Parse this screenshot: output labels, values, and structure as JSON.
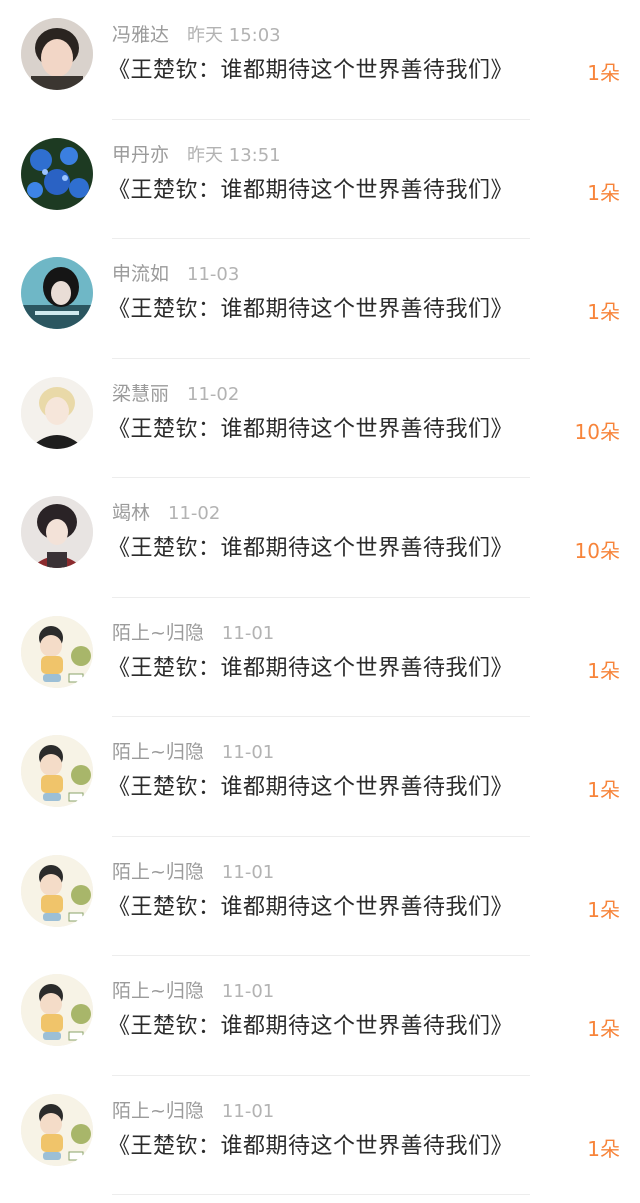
{
  "feed": {
    "items": [
      {
        "username": "冯雅达",
        "time": "昨天 15:03",
        "title": "《王楚钦：谁都期待这个世界善待我们》",
        "count": "1朵",
        "avatar": "photo-portrait"
      },
      {
        "username": "甲丹亦",
        "time": "昨天 13:51",
        "title": "《王楚钦：谁都期待这个世界善待我们》",
        "count": "1朵",
        "avatar": "blue-flowers"
      },
      {
        "username": "申流如",
        "time": "11-03",
        "title": "《王楚钦：谁都期待这个世界善待我们》",
        "count": "1朵",
        "avatar": "anime-dark"
      },
      {
        "username": "梁慧丽",
        "time": "11-02",
        "title": "《王楚钦：谁都期待这个世界善待我们》",
        "count": "10朵",
        "avatar": "anime-blond"
      },
      {
        "username": "竭林",
        "time": "11-02",
        "title": "《王楚钦：谁都期待这个世界善待我们》",
        "count": "10朵",
        "avatar": "anime-dark-hair"
      },
      {
        "username": "陌上~归隐",
        "time": "11-01",
        "title": "《王楚钦：谁都期待这个世界善待我们》",
        "count": "1朵",
        "avatar": "cartoon-kid"
      },
      {
        "username": "陌上~归隐",
        "time": "11-01",
        "title": "《王楚钦：谁都期待这个世界善待我们》",
        "count": "1朵",
        "avatar": "cartoon-kid"
      },
      {
        "username": "陌上~归隐",
        "time": "11-01",
        "title": "《王楚钦：谁都期待这个世界善待我们》",
        "count": "1朵",
        "avatar": "cartoon-kid"
      },
      {
        "username": "陌上~归隐",
        "time": "11-01",
        "title": "《王楚钦：谁都期待这个世界善待我们》",
        "count": "1朵",
        "avatar": "cartoon-kid"
      },
      {
        "username": "陌上~归隐",
        "time": "11-01",
        "title": "《王楚钦：谁都期待这个世界善待我们》",
        "count": "1朵",
        "avatar": "cartoon-kid"
      }
    ]
  },
  "colors": {
    "accent": "#f7843a",
    "username": "#9b9b9b",
    "time": "#b3b3b3",
    "title": "#2b2b2b",
    "divider": "#ededed"
  }
}
